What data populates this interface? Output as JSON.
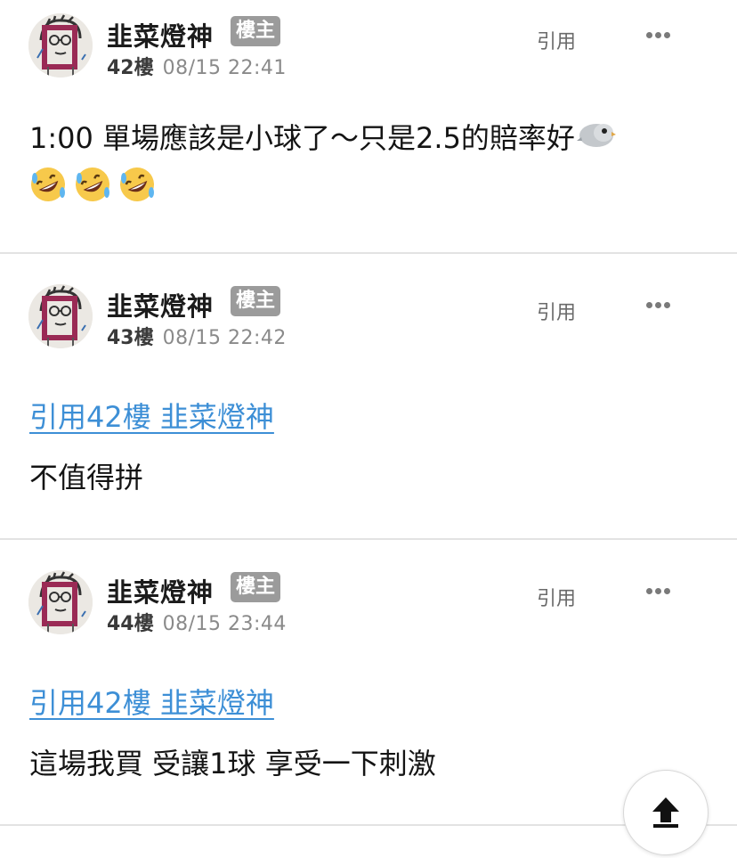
{
  "posts": [
    {
      "username": "韭菜燈神",
      "badge": "樓主",
      "floor": "42樓",
      "time": "08/15 22:41",
      "quote_label": "引用",
      "content_text": "1:00 單場應該是小球了～只是2.5的賠率好",
      "emojis": [
        "bird-emoji",
        "rofl-emoji",
        "rofl-emoji",
        "rofl-emoji"
      ]
    },
    {
      "username": "韭菜燈神",
      "badge": "樓主",
      "floor": "43樓",
      "time": "08/15 22:42",
      "quote_label": "引用",
      "quote_ref": "引用42樓 韭菜燈神",
      "content_text": "不值得拼"
    },
    {
      "username": "韭菜燈神",
      "badge": "樓主",
      "floor": "44樓",
      "time": "08/15 23:44",
      "quote_label": "引用",
      "quote_ref": "引用42樓 韭菜燈神",
      "content_text": "這場我買 受讓1球 享受一下刺激"
    }
  ],
  "icons": {
    "more": "more-dots-icon",
    "scroll_top": "arrow-up-icon",
    "avatar": "avatar-sketch"
  },
  "colors": {
    "badge_bg": "#9b9b9b",
    "link": "#3d8fd6",
    "divider": "#e3e3e3"
  }
}
